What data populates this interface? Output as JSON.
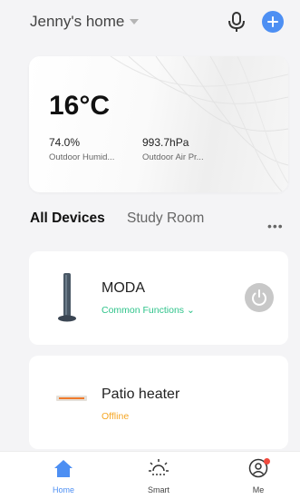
{
  "home": {
    "name": "Jenny's home"
  },
  "weather": {
    "temperature": "16°C",
    "humidity": {
      "value": "74.0%",
      "label": "Outdoor Humid..."
    },
    "pressure": {
      "value": "993.7hPa",
      "label": "Outdoor Air Pr..."
    }
  },
  "tabs": {
    "all": "All Devices",
    "room": "Study Room",
    "more": "•••"
  },
  "devices": [
    {
      "name": "MODA",
      "status": "Common Functions ⌄",
      "status_color": "#2ec38a"
    },
    {
      "name": "Patio heater",
      "status": "Offline",
      "status_color": "#f5a623"
    }
  ],
  "tabbar": [
    {
      "label": "Home",
      "icon": "home-icon",
      "active": true
    },
    {
      "label": "Smart",
      "icon": "sun-icon"
    },
    {
      "label": "Me",
      "icon": "user-icon"
    }
  ],
  "colors": {
    "accent": "#4d8ff3",
    "online": "#2ec38a",
    "offline": "#f5a623",
    "badge": "#f04a3e"
  }
}
